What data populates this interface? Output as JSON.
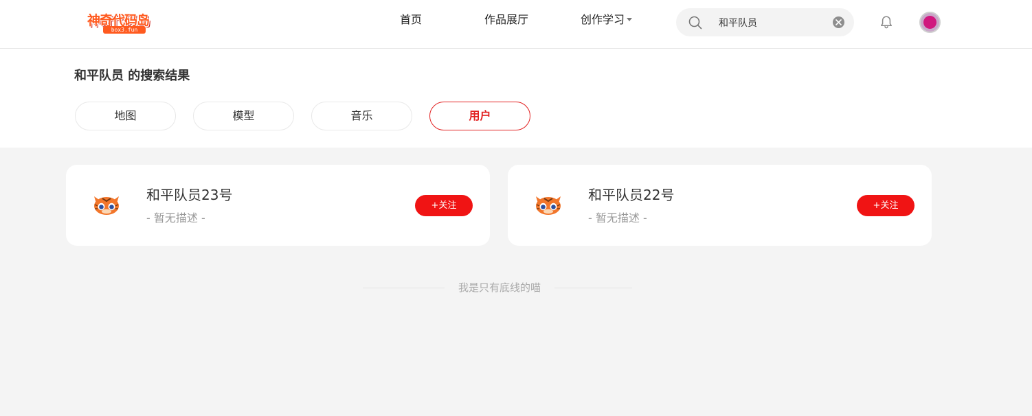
{
  "header": {
    "logo": {
      "text": "神奇代码岛",
      "sub": "box3.fun"
    },
    "nav": [
      {
        "label": "首页"
      },
      {
        "label": "作品展厅"
      },
      {
        "label": "创作学习",
        "icon": "caret-down-icon"
      }
    ],
    "search": {
      "value": "和平队员",
      "icon": "search-icon",
      "clear_icon": "clear-icon"
    },
    "notification_icon": "bell-icon",
    "avatar_icon": "user-avatar"
  },
  "results": {
    "title": "和平队员 的搜索结果",
    "tabs": [
      {
        "label": "地图",
        "active": false
      },
      {
        "label": "模型",
        "active": false
      },
      {
        "label": "音乐",
        "active": false
      },
      {
        "label": "用户",
        "active": true
      }
    ]
  },
  "users": [
    {
      "name": "和平队员23号",
      "description": "- 暂无描述 -",
      "follow_label": "+关注",
      "avatar_icon": "tiger-avatar-icon"
    },
    {
      "name": "和平队员22号",
      "description": "- 暂无描述 -",
      "follow_label": "+关注",
      "avatar_icon": "tiger-avatar-icon"
    }
  ],
  "footer": {
    "end_text": "我是只有底线的喵"
  },
  "colors": {
    "accent": "#f01414",
    "tab_active": "#e22121",
    "logo": "#ff5a1f",
    "background": "#f4f4f4"
  }
}
